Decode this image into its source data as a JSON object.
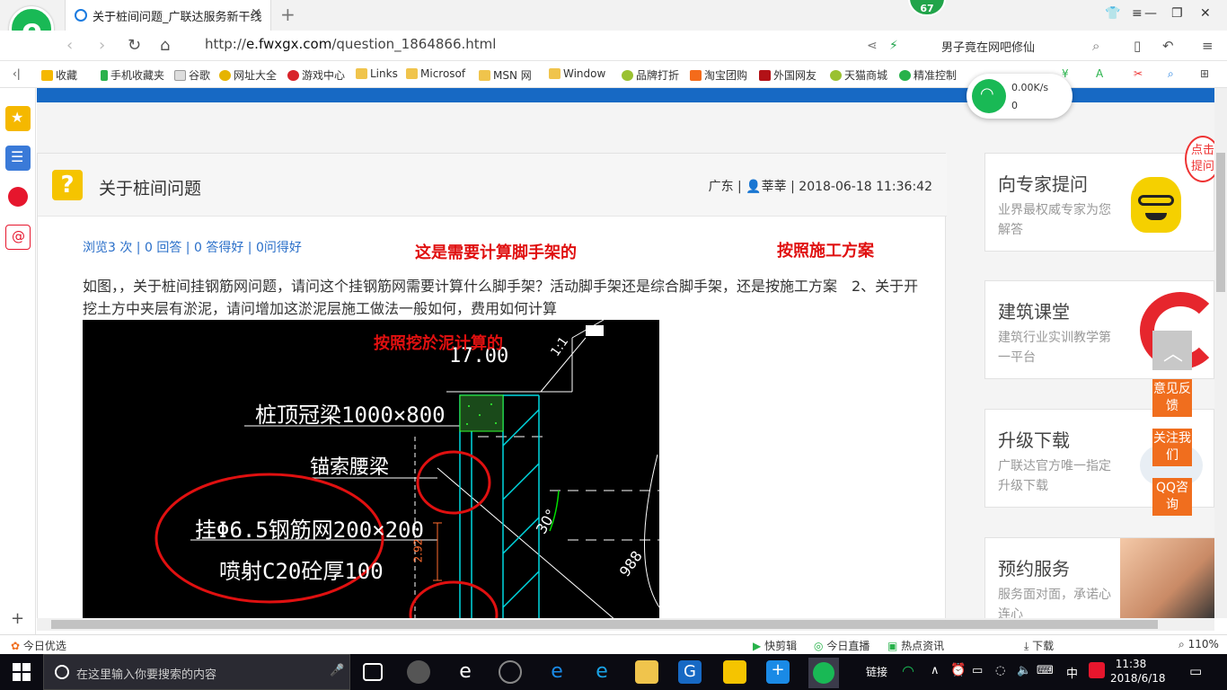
{
  "browser": {
    "tab_title": "关于桩间问题_广联达服务新干线",
    "badge_count": "67",
    "url_prefix": "http://",
    "url_domain": "e.fwxgx.com",
    "url_path": "/question_1864866.html",
    "search_query": "男子竟在网吧修仙"
  },
  "bookmarks": [
    "收藏",
    "手机收藏夹",
    "谷歌",
    "网址大全",
    "游戏中心",
    "Links",
    "Microsof",
    "MSN 网",
    "Window",
    "品牌打折",
    "淘宝团购",
    "外国网友",
    "天猫商城",
    "精准控制"
  ],
  "wifi": {
    "speed": "0.00K/s",
    "devices": "0"
  },
  "question": {
    "title": "关于桩间问题",
    "region": "广东",
    "author": "莘莘",
    "time": "2018-06-18 11:36:42",
    "stats": [
      "浏览3 次",
      "0 回答",
      "0 答得好",
      "0问得好"
    ],
    "body": "如图，，关于桩间挂钢筋网问题，请问这个挂钢筋网需要计算什么脚手架？活动脚手架还是综合脚手架，还是按施工方案　2、关于开挖土方中夹层有淤泥，请问增加这淤泥层施工做法一般如何，费用如何计算",
    "annotations": [
      "这是需要计算脚手架的",
      "按照施工方案",
      "按照挖於泥计算的"
    ],
    "cad_labels": {
      "elevation": "17.00",
      "cap_beam": "桩顶冠梁1000×800",
      "anchor_beam": "锚索腰梁",
      "mesh": "挂Φ6.5钢筋网200×200",
      "spray": "喷射C20砼厚100",
      "angle": "30°",
      "dim_988": "988",
      "dim_292": "2.92",
      "slope": "1:1"
    }
  },
  "sidebar_cards": [
    {
      "heading": "向专家提问",
      "sub": "业界最权威专家为您解答"
    },
    {
      "heading": "建筑课堂",
      "sub": "建筑行业实训教学第一平台"
    },
    {
      "heading": "升级下载",
      "sub": "广联达官方唯一指定升级下载"
    },
    {
      "heading": "预约服务",
      "sub": "服务面对面，承诺心连心"
    }
  ],
  "promo_bubble": [
    "点击",
    "提问"
  ],
  "float_buttons": [
    "意见反馈",
    "关注我们",
    "QQ咨询"
  ],
  "status_bar": {
    "left": "今日优选",
    "items": [
      "快剪辑",
      "今日直播",
      "热点资讯",
      "下载"
    ],
    "zoom": "110%"
  },
  "taskbar": {
    "search_placeholder": "在这里输入你要搜索的内容",
    "link_label": "链接",
    "ime": "中",
    "time": "11:38",
    "date": "2018/6/18"
  },
  "colors": {
    "brand_green": "#19b955",
    "header_blue": "#1769c4",
    "float_orange": "#f06e1e",
    "annotation_red": "#e01010"
  }
}
